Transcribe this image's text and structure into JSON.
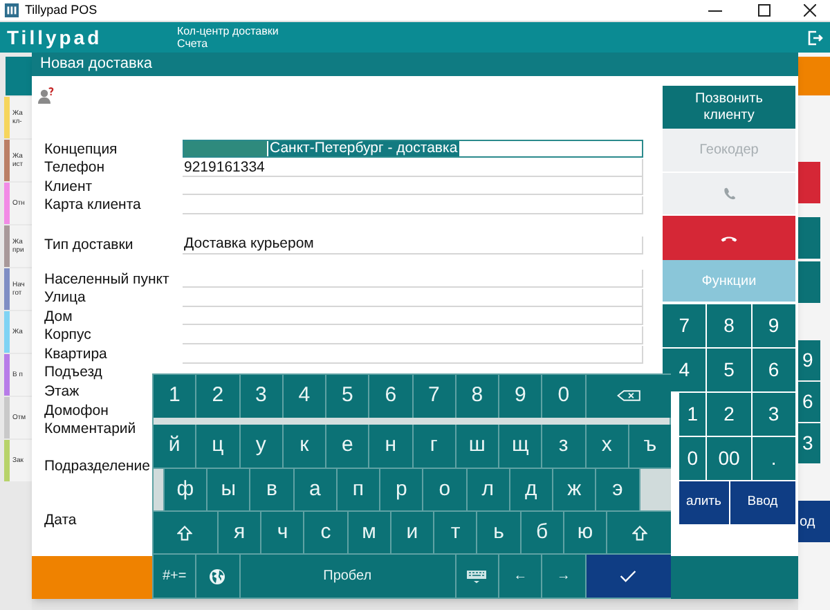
{
  "window": {
    "title": "Tillypad POS"
  },
  "header": {
    "logo": "Tillypad",
    "title": "Кол-центр доставки",
    "subtitle": "Счета"
  },
  "background": {
    "cards": [
      {
        "lines": [
          "Жа",
          "кл-"
        ],
        "color": "#f6d55c"
      },
      {
        "lines": [
          "Жа",
          "ист"
        ],
        "color": "#bb7f66"
      },
      {
        "lines": [
          "Отн"
        ],
        "color": "#f28be6"
      },
      {
        "lines": [
          "Жа",
          "при"
        ],
        "color": "#a8999a"
      },
      {
        "lines": [
          "Нач",
          "гот"
        ],
        "color": "#7f8ec4"
      },
      {
        "lines": [
          "Жа"
        ],
        "color": "#7fd3f4"
      },
      {
        "lines": [
          "В п"
        ],
        "color": "#b77ce8"
      },
      {
        "lines": [
          "Отм"
        ],
        "color": "#c9c9c9"
      },
      {
        "lines": [
          "Зак"
        ],
        "color": "#b7d36a"
      }
    ],
    "right_keys": [
      "9",
      "6",
      "3"
    ],
    "right_enter": "од"
  },
  "dialog": {
    "title": "Новая доставка",
    "sections": [
      [
        {
          "label": "Концепция",
          "kind": "combo",
          "value": "Санкт-Петербург - доставка",
          "selected": true
        },
        {
          "label": "Телефон",
          "kind": "text",
          "value": "9219161334"
        },
        {
          "label": "Клиент",
          "kind": "text"
        },
        {
          "label": "Карта клиента",
          "kind": "text"
        }
      ],
      [
        {
          "label": "Тип доставки",
          "kind": "text",
          "value": "Доставка курьером"
        }
      ],
      [
        {
          "label": "Населенный пункт",
          "kind": "text"
        },
        {
          "label": "Улица",
          "kind": "text"
        },
        {
          "label": "Дом",
          "kind": "text"
        },
        {
          "label": "Корпус",
          "kind": "text"
        },
        {
          "label": "Квартира",
          "kind": "text"
        },
        {
          "label": "Подъезд",
          "kind": "label"
        },
        {
          "label": "Этаж",
          "kind": "label"
        },
        {
          "label": "Домофон",
          "kind": "label"
        },
        {
          "label": "Комментарий",
          "kind": "label"
        }
      ],
      [
        {
          "label": "Подразделение",
          "kind": "label"
        }
      ],
      [
        {
          "label": "Дата",
          "kind": "label"
        }
      ]
    ],
    "side_buttons": [
      {
        "kind": "primary",
        "label": "Позвонить клиенту",
        "disabled": false
      },
      {
        "kind": "primary",
        "label": "Геокодер",
        "disabled": true
      },
      {
        "kind": "phone",
        "disabled": true
      },
      {
        "kind": "hangup",
        "disabled": false
      },
      {
        "kind": "secondary",
        "label": "Функции",
        "disabled": false
      }
    ],
    "numpad": [
      [
        "7",
        "8",
        "9"
      ],
      [
        "4",
        "5",
        "6"
      ],
      [
        "1",
        "2",
        "3"
      ],
      [
        "0",
        "00",
        "."
      ]
    ],
    "numpad_actions": [
      "алить",
      "Ввод"
    ]
  },
  "keyboard": {
    "rows": [
      {
        "keys": [
          {
            "kind": "char",
            "label": "1"
          },
          {
            "kind": "char",
            "label": "2"
          },
          {
            "kind": "char",
            "label": "3"
          },
          {
            "kind": "char",
            "label": "4"
          },
          {
            "kind": "char",
            "label": "5"
          },
          {
            "kind": "char",
            "label": "6"
          },
          {
            "kind": "char",
            "label": "7"
          },
          {
            "kind": "char",
            "label": "8"
          },
          {
            "kind": "char",
            "label": "9"
          },
          {
            "kind": "char",
            "label": "0"
          },
          {
            "kind": "backspace"
          }
        ]
      },
      {
        "keys": [
          {
            "kind": "char",
            "label": "й"
          },
          {
            "kind": "char",
            "label": "ц"
          },
          {
            "kind": "char",
            "label": "у"
          },
          {
            "kind": "char",
            "label": "к"
          },
          {
            "kind": "char",
            "label": "е"
          },
          {
            "kind": "char",
            "label": "н"
          },
          {
            "kind": "char",
            "label": "г"
          },
          {
            "kind": "char",
            "label": "ш"
          },
          {
            "kind": "char",
            "label": "щ"
          },
          {
            "kind": "char",
            "label": "з"
          },
          {
            "kind": "char",
            "label": "х"
          },
          {
            "kind": "char",
            "label": "ъ"
          }
        ]
      },
      {
        "keys": [
          {
            "kind": "blank"
          },
          {
            "kind": "char",
            "label": "ф"
          },
          {
            "kind": "char",
            "label": "ы"
          },
          {
            "kind": "char",
            "label": "в"
          },
          {
            "kind": "char",
            "label": "а"
          },
          {
            "kind": "char",
            "label": "п"
          },
          {
            "kind": "char",
            "label": "р"
          },
          {
            "kind": "char",
            "label": "о"
          },
          {
            "kind": "char",
            "label": "л"
          },
          {
            "kind": "char",
            "label": "д"
          },
          {
            "kind": "char",
            "label": "ж"
          },
          {
            "kind": "char",
            "label": "э"
          },
          {
            "kind": "blank"
          }
        ]
      },
      {
        "keys": [
          {
            "kind": "shift"
          },
          {
            "kind": "char",
            "label": "я"
          },
          {
            "kind": "char",
            "label": "ч"
          },
          {
            "kind": "char",
            "label": "с"
          },
          {
            "kind": "char",
            "label": "м"
          },
          {
            "kind": "char",
            "label": "и"
          },
          {
            "kind": "char",
            "label": "т"
          },
          {
            "kind": "char",
            "label": "ь"
          },
          {
            "kind": "char",
            "label": "б"
          },
          {
            "kind": "char",
            "label": "ю"
          },
          {
            "kind": "shift"
          }
        ]
      },
      {
        "keys": [
          {
            "kind": "small",
            "label": "#+="
          },
          {
            "kind": "globe"
          },
          {
            "kind": "space",
            "label": "Пробел"
          },
          {
            "kind": "hide"
          },
          {
            "kind": "small",
            "label": "←"
          },
          {
            "kind": "small",
            "label": "→"
          },
          {
            "kind": "done"
          }
        ]
      }
    ]
  }
}
